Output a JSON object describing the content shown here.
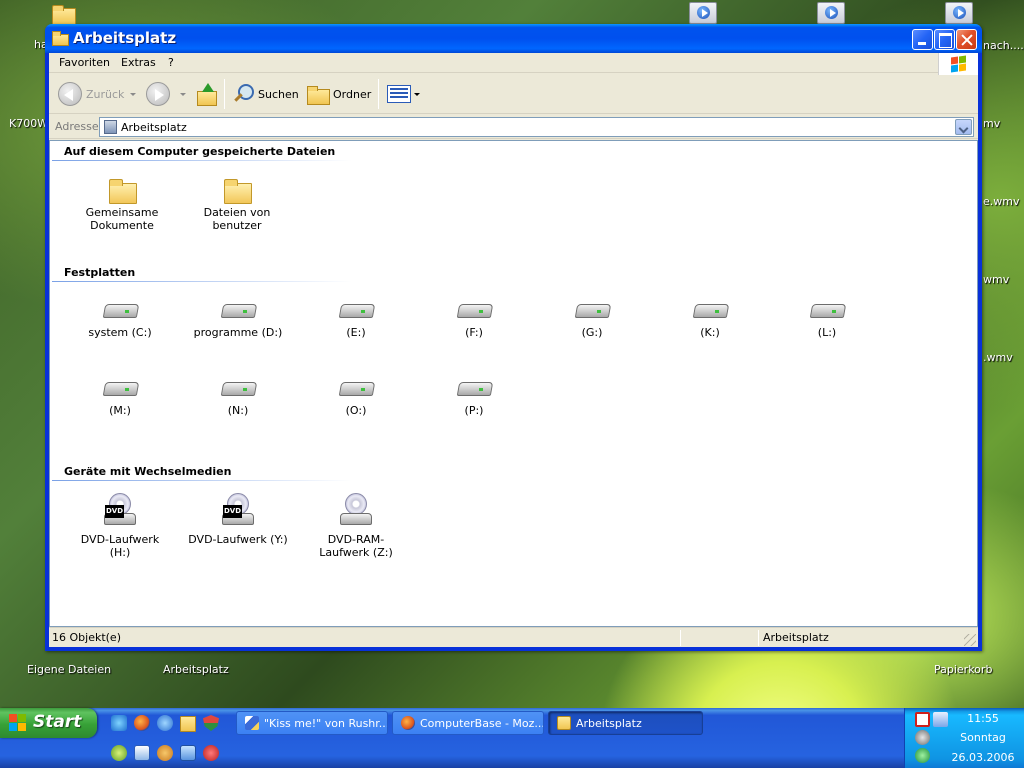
{
  "desktop": {
    "left_labels": [
      "ha",
      "K700W"
    ],
    "right_labels": [
      "nach....",
      "mv",
      "e.wmv",
      "wmv",
      ".wmv"
    ],
    "bottom_icons": [
      "Eigene Dateien",
      "Arbeitsplatz",
      "Papierkorb"
    ]
  },
  "window": {
    "title": "Arbeitsplatz",
    "menu": [
      "Favoriten",
      "Extras",
      "?"
    ],
    "toolbar": {
      "back": "Zurück",
      "search": "Suchen",
      "folders": "Ordner"
    },
    "address": {
      "label": "Adresse",
      "value": "Arbeitsplatz"
    },
    "groups": [
      {
        "header": "Auf diesem Computer gespeicherte Dateien",
        "items": [
          {
            "label": "Gemeinsame Dokumente",
            "icon": "folder-icon"
          },
          {
            "label": "Dateien von benutzer",
            "icon": "folder-icon"
          }
        ]
      },
      {
        "header": "Festplatten",
        "items": [
          {
            "label": "system (C:)",
            "icon": "hard-drive-icon"
          },
          {
            "label": "programme (D:)",
            "icon": "hard-drive-icon"
          },
          {
            "label": "(E:)",
            "icon": "hard-drive-icon"
          },
          {
            "label": "(F:)",
            "icon": "hard-drive-icon"
          },
          {
            "label": "(G:)",
            "icon": "hard-drive-icon"
          },
          {
            "label": "(K:)",
            "icon": "hard-drive-icon"
          },
          {
            "label": "(L:)",
            "icon": "hard-drive-icon"
          },
          {
            "label": "(M:)",
            "icon": "hard-drive-icon"
          },
          {
            "label": "(N:)",
            "icon": "hard-drive-icon"
          },
          {
            "label": "(O:)",
            "icon": "hard-drive-icon"
          },
          {
            "label": "(P:)",
            "icon": "hard-drive-icon"
          }
        ]
      },
      {
        "header": "Geräte mit Wechselmedien",
        "items": [
          {
            "label": "DVD-Laufwerk (H:)",
            "icon": "dvd-drive-icon"
          },
          {
            "label": "DVD-Laufwerk (Y:)",
            "icon": "dvd-drive-icon"
          },
          {
            "label": "DVD-RAM-Laufwerk (Z:)",
            "icon": "dvd-ram-drive-icon"
          }
        ]
      }
    ],
    "dvd_tag": "DVD",
    "status": {
      "count": "16 Objekt(e)",
      "location": "Arbeitsplatz"
    }
  },
  "taskbar": {
    "start": "Start",
    "tasks": [
      {
        "label": "\"Kiss me!\" von Rushr...",
        "active": false
      },
      {
        "label": "ComputerBase - Moz...",
        "active": false
      },
      {
        "label": "Arbeitsplatz",
        "active": true
      }
    ],
    "clock": {
      "time": "11:55",
      "day": "Sonntag",
      "date": "26.03.2006"
    }
  },
  "colors": {
    "title_bar": "#0053ee",
    "taskbar": "#245edb",
    "start_button": "#37a137",
    "tray": "#0f94e3"
  }
}
